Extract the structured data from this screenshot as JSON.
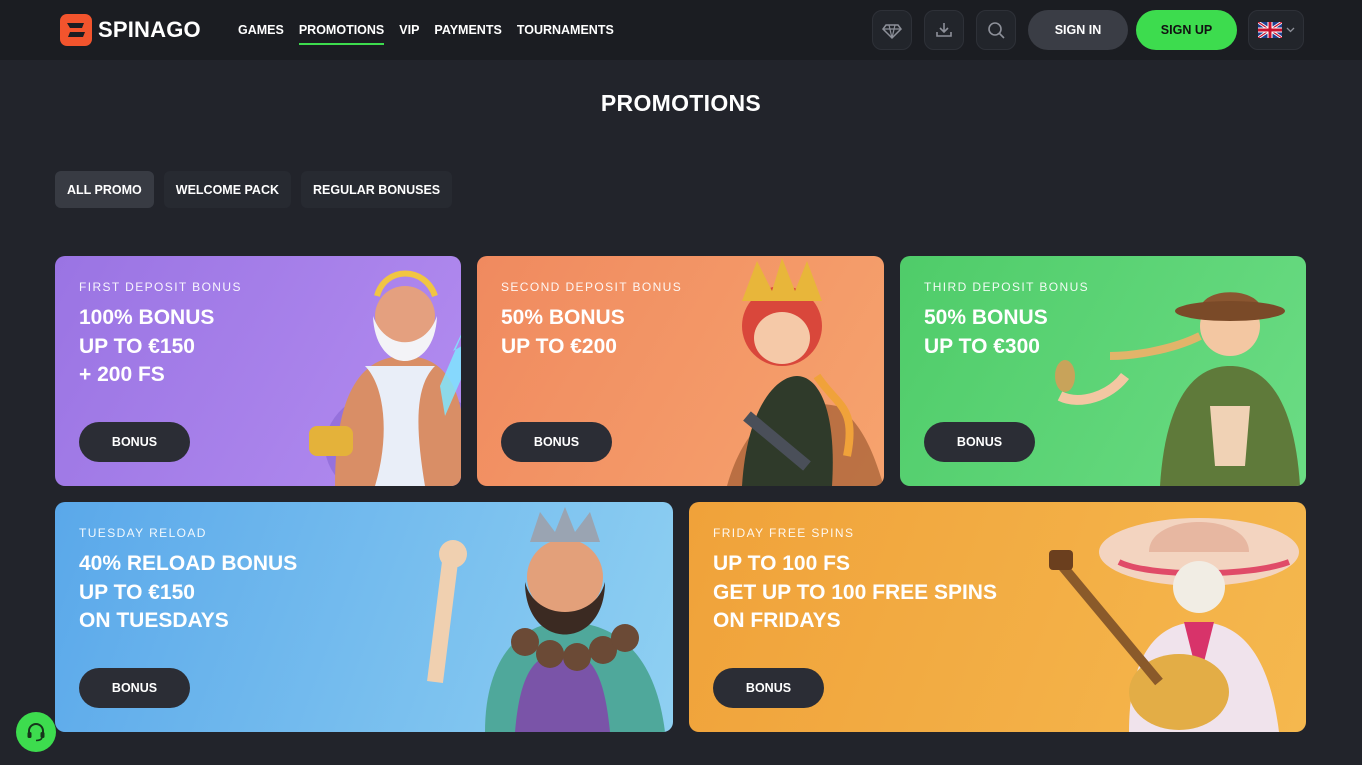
{
  "brand": {
    "name": "SPINAGO",
    "accent": "#3ddc4e"
  },
  "nav": {
    "items": [
      {
        "label": "GAMES"
      },
      {
        "label": "PROMOTIONS",
        "active": true
      },
      {
        "label": "VIP"
      },
      {
        "label": "PAYMENTS"
      },
      {
        "label": "TOURNAMENTS"
      }
    ]
  },
  "header": {
    "icons": [
      "vip-diamond-icon",
      "download-icon",
      "search-icon"
    ],
    "sign_in": "SIGN IN",
    "sign_up": "SIGN UP",
    "language": "uk-flag-icon"
  },
  "page": {
    "title": "PROMOTIONS"
  },
  "filters": [
    {
      "label": "ALL PROMO",
      "active": true
    },
    {
      "label": "WELCOME PACK"
    },
    {
      "label": "REGULAR BONUSES"
    }
  ],
  "cards": [
    {
      "kicker": "FIRST DEPOSIT BONUS",
      "headline": "100% BONUS\nUP TO €150\n+ 200 FS",
      "button": "BONUS",
      "color": "#a07ae6"
    },
    {
      "kicker": "SECOND DEPOSIT BONUS",
      "headline": "50% BONUS\nUP TO €200",
      "button": "BONUS",
      "color": "#f3895e"
    },
    {
      "kicker": "THIRD DEPOSIT BONUS",
      "headline": "50% BONUS\nUP TO €300",
      "button": "BONUS",
      "color": "#57cf6d"
    },
    {
      "kicker": "TUESDAY RELOAD",
      "headline": "40% RELOAD BONUS\nUP TO €150\nON TUESDAYS",
      "button": "BONUS",
      "color": "#6fb4ea"
    },
    {
      "kicker": "FRIDAY FREE SPINS",
      "headline": "UP TO 100 FS\nGET UP TO 100 FREE SPINS\nON FRIDAYS",
      "button": "BONUS",
      "color": "#f0a23a"
    }
  ]
}
